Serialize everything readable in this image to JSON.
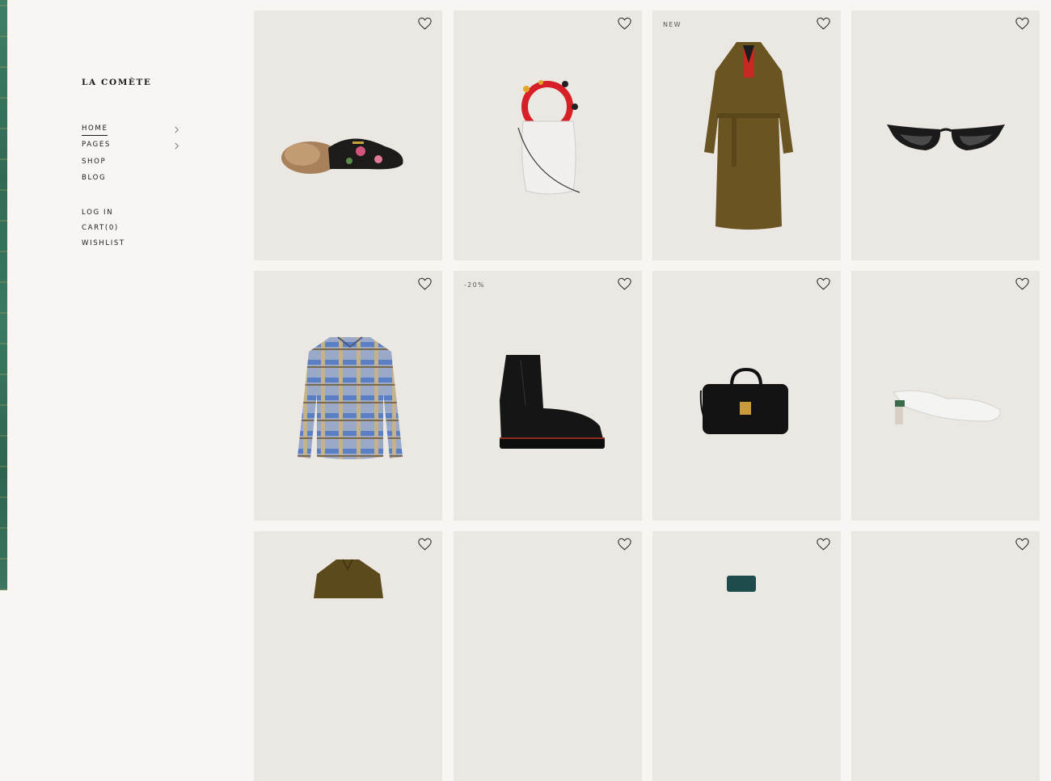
{
  "brand": {
    "name": "LA COMÈTE"
  },
  "nav": {
    "primary": [
      {
        "label": "HOME",
        "active": true,
        "has_submenu": true
      },
      {
        "label": "PAGES",
        "active": false,
        "has_submenu": true
      },
      {
        "label": "SHOP",
        "active": false,
        "has_submenu": false
      },
      {
        "label": "BLOG",
        "active": false,
        "has_submenu": false
      }
    ],
    "secondary": [
      {
        "label": "LOG IN"
      },
      {
        "label": "CART(0)"
      },
      {
        "label": "WISHLIST"
      }
    ]
  },
  "products": [
    {
      "badge": "",
      "item": "fur-loafer"
    },
    {
      "badge": "",
      "item": "bucket-bag"
    },
    {
      "badge": "NEW",
      "item": "trench-coat"
    },
    {
      "badge": "",
      "item": "cat-eye-sunglasses"
    },
    {
      "badge": "",
      "item": "plaid-shirt"
    },
    {
      "badge": "-20%",
      "item": "combat-boot"
    },
    {
      "badge": "",
      "item": "leather-handbag"
    },
    {
      "badge": "",
      "item": "white-mule"
    },
    {
      "badge": "",
      "item": "olive-jacket"
    },
    {
      "badge": "",
      "item": "empty"
    },
    {
      "badge": "",
      "item": "teal-item"
    },
    {
      "badge": "",
      "item": "empty"
    }
  ],
  "colors": {
    "background": "#f8f5f2",
    "card": "#ebe8e4",
    "text": "#1a1a1a",
    "strip": "#3f7e67"
  }
}
